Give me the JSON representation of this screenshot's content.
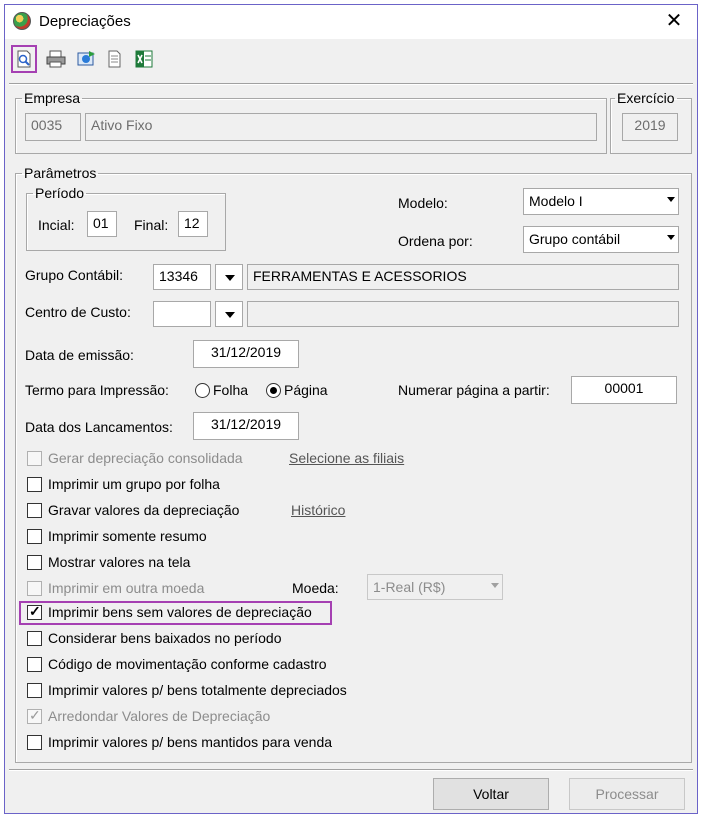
{
  "window": {
    "title": "Depreciações"
  },
  "toolbar": {
    "buttons": [
      {
        "icon": "preview-icon"
      },
      {
        "icon": "printer-icon"
      },
      {
        "icon": "export-icon"
      },
      {
        "icon": "document-icon"
      },
      {
        "icon": "excel-icon"
      }
    ]
  },
  "empresa": {
    "legend": "Empresa",
    "code": "0035",
    "name": "Ativo Fixo"
  },
  "exercicio": {
    "legend": "Exercício",
    "year": "2019"
  },
  "parametros": {
    "legend": "Parâmetros",
    "periodo": {
      "legend": "Período",
      "inicial_label": "Incial:",
      "inicial_value": "01",
      "final_label": "Final:",
      "final_value": "12"
    },
    "modelo": {
      "label": "Modelo:",
      "value": "Modelo I"
    },
    "ordena": {
      "label": "Ordena por:",
      "value": "Grupo contábil"
    },
    "grupo": {
      "label": "Grupo Contábil:",
      "code": "13346",
      "description": "FERRAMENTAS E ACESSORIOS"
    },
    "centro": {
      "label": "Centro de Custo:",
      "code": "",
      "description": ""
    },
    "data_emissao": {
      "label": "Data de emissão:",
      "value": "31/12/2019"
    },
    "termo": {
      "label": "Termo para Impressão:",
      "option_folha": "Folha",
      "option_pagina": "Página",
      "selected": "Página"
    },
    "numerar": {
      "label": "Numerar página a partir:",
      "value": "00001"
    },
    "data_lanc": {
      "label": "Data dos Lancamentos:",
      "value": "31/12/2019"
    },
    "links": {
      "filiais": "Selecione as filiais",
      "historico": "Histórico"
    },
    "moeda": {
      "label": "Moeda:",
      "value": "1-Real (R$)"
    },
    "checks": [
      {
        "label": "Gerar depreciação consolidada",
        "checked": false,
        "enabled": false
      },
      {
        "label": "Imprimir um grupo por folha",
        "checked": false,
        "enabled": true
      },
      {
        "label": "Gravar valores da depreciação",
        "checked": false,
        "enabled": true
      },
      {
        "label": "Imprimir somente resumo",
        "checked": false,
        "enabled": true
      },
      {
        "label": "Mostrar valores na tela",
        "checked": false,
        "enabled": true
      },
      {
        "label": "Imprimir em outra moeda",
        "checked": false,
        "enabled": false
      },
      {
        "label": "Imprimir bens sem valores de depreciação",
        "checked": true,
        "enabled": true
      },
      {
        "label": "Considerar bens baixados no período",
        "checked": false,
        "enabled": true
      },
      {
        "label": "Código de movimentação conforme cadastro",
        "checked": false,
        "enabled": true
      },
      {
        "label": "Imprimir valores p/ bens totalmente depreciados",
        "checked": false,
        "enabled": true
      },
      {
        "label": "Arredondar Valores de Depreciação",
        "checked": true,
        "enabled": false
      },
      {
        "label": "Imprimir valores p/ bens mantidos para venda",
        "checked": false,
        "enabled": true
      }
    ]
  },
  "buttons": {
    "voltar": "Voltar",
    "processar": "Processar"
  },
  "colors": {
    "highlight": "#a540b2",
    "window_border": "#6b63c8",
    "disabled_text": "#8c8c8c"
  }
}
